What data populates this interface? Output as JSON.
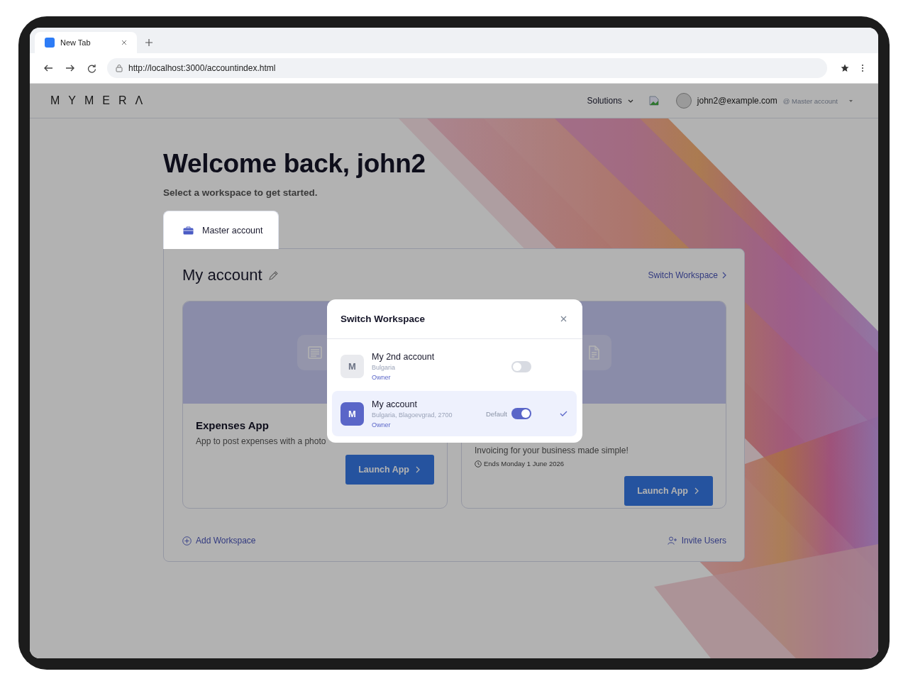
{
  "browser": {
    "tab": {
      "title": "New Tab"
    },
    "url": "http://localhost:3000/accountindex.html"
  },
  "header": {
    "logo": "MYMERΛ",
    "menu": "Solutions",
    "user_email": "john2@example.com",
    "user_workspace": "@ Master account"
  },
  "welcome": {
    "title": "Welcome back, john2",
    "subtitle": "Select a workspace to get started."
  },
  "account_tabs": [
    {
      "label": "Master account",
      "selected": true
    }
  ],
  "panel": {
    "title": "My account",
    "switch_link": "Switch Workspace",
    "apps": [
      {
        "kind": "receipt",
        "title": "Expenses App",
        "description": "App to post expenses with a photo",
        "button": "Launch App"
      },
      {
        "kind": "document",
        "description": "Invoicing for your business made simple!",
        "ends": "Ends Monday 1 June 2026",
        "button": "Launch App"
      }
    ],
    "add_link": "Add Workspace",
    "invite_link": "Invite Users"
  },
  "modal": {
    "title": "Switch Workspace",
    "workspaces": [
      {
        "initial": "M",
        "name": "My 2nd account",
        "location": "Bulgaria",
        "role": "Owner",
        "default": false,
        "selected": false
      },
      {
        "initial": "M",
        "name": "My account",
        "location": "Bulgaria, Blagoevgrad, 2700",
        "role": "Owner",
        "toggle_label": "Default",
        "default": true,
        "selected": true
      }
    ]
  }
}
